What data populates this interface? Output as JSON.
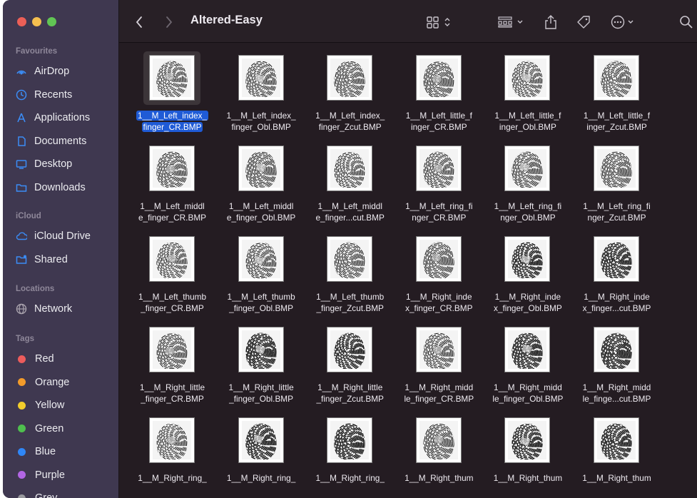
{
  "window": {
    "title": "Altered-Easy"
  },
  "traffic_lights": {
    "close": "#ec5f57",
    "minimize": "#f5bf4f",
    "zoom": "#61c554"
  },
  "sidebar": {
    "favourites_title": "Favourites",
    "favourites": [
      {
        "label": "AirDrop",
        "icon": "airdrop-icon"
      },
      {
        "label": "Recents",
        "icon": "clock-icon"
      },
      {
        "label": "Applications",
        "icon": "applications-icon"
      },
      {
        "label": "Documents",
        "icon": "document-icon"
      },
      {
        "label": "Desktop",
        "icon": "desktop-icon"
      },
      {
        "label": "Downloads",
        "icon": "downloads-folder-icon"
      }
    ],
    "icloud_title": "iCloud",
    "icloud": [
      {
        "label": "iCloud Drive",
        "icon": "cloud-icon"
      },
      {
        "label": "Shared",
        "icon": "shared-folder-icon"
      }
    ],
    "locations_title": "Locations",
    "locations": [
      {
        "label": "Network",
        "icon": "globe-icon"
      }
    ],
    "tags_title": "Tags",
    "tags": [
      {
        "label": "Red",
        "color": "#ec5c5c"
      },
      {
        "label": "Orange",
        "color": "#f39b2a"
      },
      {
        "label": "Yellow",
        "color": "#f2cd2c"
      },
      {
        "label": "Green",
        "color": "#4fbf4e"
      },
      {
        "label": "Blue",
        "color": "#2f86f6"
      },
      {
        "label": "Purple",
        "color": "#b266e4"
      },
      {
        "label": "Grey",
        "color": "#98989d"
      }
    ]
  },
  "toolbar": {
    "back_icon": "chevron-left-icon",
    "forward_icon": "chevron-right-icon",
    "view_icon": "icon-view-grid-icon",
    "group_icon": "group-by-icon",
    "share_icon": "share-icon",
    "tag_icon": "tag-icon",
    "more_icon": "more-actions-icon",
    "search_icon": "search-icon"
  },
  "accent": "#1f5bd6",
  "files": [
    {
      "line1": "1__M_Left_index_",
      "line2": "finger_CR.BMP",
      "selected": true,
      "var": 0
    },
    {
      "line1": "1__M_Left_index_",
      "line2": "finger_Obl.BMP",
      "var": 1
    },
    {
      "line1": "1__M_Left_index_",
      "line2": "finger_Zcut.BMP",
      "var": 2
    },
    {
      "line1": "1__M_Left_little_f",
      "line2": "inger_CR.BMP",
      "var": 3
    },
    {
      "line1": "1__M_Left_little_f",
      "line2": "inger_Obl.BMP",
      "var": 4
    },
    {
      "line1": "1__M_Left_little_f",
      "line2": "inger_Zcut.BMP",
      "var": 5
    },
    {
      "line1": "1__M_Left_middl",
      "line2": "e_finger_CR.BMP",
      "var": 6
    },
    {
      "line1": "1__M_Left_middl",
      "line2": "e_finger_Obl.BMP",
      "var": 7
    },
    {
      "line1": "1__M_Left_middl",
      "line2": "e_finger...cut.BMP",
      "var": 8
    },
    {
      "line1": "1__M_Left_ring_fi",
      "line2": "nger_CR.BMP",
      "var": 9
    },
    {
      "line1": "1__M_Left_ring_fi",
      "line2": "nger_Obl.BMP",
      "var": 10
    },
    {
      "line1": "1__M_Left_ring_fi",
      "line2": "nger_Zcut.BMP",
      "var": 11
    },
    {
      "line1": "1__M_Left_thumb",
      "line2": "_finger_CR.BMP",
      "var": 12
    },
    {
      "line1": "1__M_Left_thumb",
      "line2": "_finger_Obl.BMP",
      "var": 13
    },
    {
      "line1": "1__M_Left_thumb",
      "line2": "_finger_Zcut.BMP",
      "var": 14
    },
    {
      "line1": "1__M_Right_inde",
      "line2": "x_finger_CR.BMP",
      "var": 15
    },
    {
      "line1": "1__M_Right_inde",
      "line2": "x_finger_Obl.BMP",
      "var": 16
    },
    {
      "line1": "1__M_Right_inde",
      "line2": "x_finger...cut.BMP",
      "var": 17
    },
    {
      "line1": "1__M_Right_little",
      "line2": "_finger_CR.BMP",
      "var": 18
    },
    {
      "line1": "1__M_Right_little",
      "line2": "_finger_Obl.BMP",
      "var": 19
    },
    {
      "line1": "1__M_Right_little",
      "line2": "_finger_Zcut.BMP",
      "var": 20
    },
    {
      "line1": "1__M_Right_midd",
      "line2": "le_finger_CR.BMP",
      "var": 21
    },
    {
      "line1": "1__M_Right_midd",
      "line2": "le_finger_Obl.BMP",
      "var": 22
    },
    {
      "line1": "1__M_Right_midd",
      "line2": "le_finge...cut.BMP",
      "var": 23
    },
    {
      "line1": "1__M_Right_ring_",
      "line2": "",
      "var": 24
    },
    {
      "line1": "1__M_Right_ring_",
      "line2": "",
      "var": 25
    },
    {
      "line1": "1__M_Right_ring_",
      "line2": "",
      "var": 26
    },
    {
      "line1": "1__M_Right_thum",
      "line2": "",
      "var": 27
    },
    {
      "line1": "1__M_Right_thum",
      "line2": "",
      "var": 28
    },
    {
      "line1": "1__M_Right_thum",
      "line2": "",
      "var": 29
    }
  ]
}
